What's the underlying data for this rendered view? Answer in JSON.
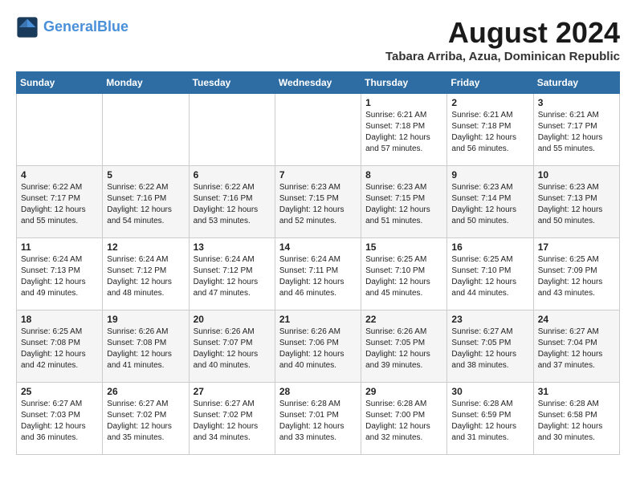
{
  "header": {
    "logo_line1": "General",
    "logo_line2": "Blue",
    "month_year": "August 2024",
    "location": "Tabara Arriba, Azua, Dominican Republic"
  },
  "days_of_week": [
    "Sunday",
    "Monday",
    "Tuesday",
    "Wednesday",
    "Thursday",
    "Friday",
    "Saturday"
  ],
  "weeks": [
    [
      {
        "day": "",
        "content": ""
      },
      {
        "day": "",
        "content": ""
      },
      {
        "day": "",
        "content": ""
      },
      {
        "day": "",
        "content": ""
      },
      {
        "day": "1",
        "content": "Sunrise: 6:21 AM\nSunset: 7:18 PM\nDaylight: 12 hours\nand 57 minutes."
      },
      {
        "day": "2",
        "content": "Sunrise: 6:21 AM\nSunset: 7:18 PM\nDaylight: 12 hours\nand 56 minutes."
      },
      {
        "day": "3",
        "content": "Sunrise: 6:21 AM\nSunset: 7:17 PM\nDaylight: 12 hours\nand 55 minutes."
      }
    ],
    [
      {
        "day": "4",
        "content": "Sunrise: 6:22 AM\nSunset: 7:17 PM\nDaylight: 12 hours\nand 55 minutes."
      },
      {
        "day": "5",
        "content": "Sunrise: 6:22 AM\nSunset: 7:16 PM\nDaylight: 12 hours\nand 54 minutes."
      },
      {
        "day": "6",
        "content": "Sunrise: 6:22 AM\nSunset: 7:16 PM\nDaylight: 12 hours\nand 53 minutes."
      },
      {
        "day": "7",
        "content": "Sunrise: 6:23 AM\nSunset: 7:15 PM\nDaylight: 12 hours\nand 52 minutes."
      },
      {
        "day": "8",
        "content": "Sunrise: 6:23 AM\nSunset: 7:15 PM\nDaylight: 12 hours\nand 51 minutes."
      },
      {
        "day": "9",
        "content": "Sunrise: 6:23 AM\nSunset: 7:14 PM\nDaylight: 12 hours\nand 50 minutes."
      },
      {
        "day": "10",
        "content": "Sunrise: 6:23 AM\nSunset: 7:13 PM\nDaylight: 12 hours\nand 50 minutes."
      }
    ],
    [
      {
        "day": "11",
        "content": "Sunrise: 6:24 AM\nSunset: 7:13 PM\nDaylight: 12 hours\nand 49 minutes."
      },
      {
        "day": "12",
        "content": "Sunrise: 6:24 AM\nSunset: 7:12 PM\nDaylight: 12 hours\nand 48 minutes."
      },
      {
        "day": "13",
        "content": "Sunrise: 6:24 AM\nSunset: 7:12 PM\nDaylight: 12 hours\nand 47 minutes."
      },
      {
        "day": "14",
        "content": "Sunrise: 6:24 AM\nSunset: 7:11 PM\nDaylight: 12 hours\nand 46 minutes."
      },
      {
        "day": "15",
        "content": "Sunrise: 6:25 AM\nSunset: 7:10 PM\nDaylight: 12 hours\nand 45 minutes."
      },
      {
        "day": "16",
        "content": "Sunrise: 6:25 AM\nSunset: 7:10 PM\nDaylight: 12 hours\nand 44 minutes."
      },
      {
        "day": "17",
        "content": "Sunrise: 6:25 AM\nSunset: 7:09 PM\nDaylight: 12 hours\nand 43 minutes."
      }
    ],
    [
      {
        "day": "18",
        "content": "Sunrise: 6:25 AM\nSunset: 7:08 PM\nDaylight: 12 hours\nand 42 minutes."
      },
      {
        "day": "19",
        "content": "Sunrise: 6:26 AM\nSunset: 7:08 PM\nDaylight: 12 hours\nand 41 minutes."
      },
      {
        "day": "20",
        "content": "Sunrise: 6:26 AM\nSunset: 7:07 PM\nDaylight: 12 hours\nand 40 minutes."
      },
      {
        "day": "21",
        "content": "Sunrise: 6:26 AM\nSunset: 7:06 PM\nDaylight: 12 hours\nand 40 minutes."
      },
      {
        "day": "22",
        "content": "Sunrise: 6:26 AM\nSunset: 7:05 PM\nDaylight: 12 hours\nand 39 minutes."
      },
      {
        "day": "23",
        "content": "Sunrise: 6:27 AM\nSunset: 7:05 PM\nDaylight: 12 hours\nand 38 minutes."
      },
      {
        "day": "24",
        "content": "Sunrise: 6:27 AM\nSunset: 7:04 PM\nDaylight: 12 hours\nand 37 minutes."
      }
    ],
    [
      {
        "day": "25",
        "content": "Sunrise: 6:27 AM\nSunset: 7:03 PM\nDaylight: 12 hours\nand 36 minutes."
      },
      {
        "day": "26",
        "content": "Sunrise: 6:27 AM\nSunset: 7:02 PM\nDaylight: 12 hours\nand 35 minutes."
      },
      {
        "day": "27",
        "content": "Sunrise: 6:27 AM\nSunset: 7:02 PM\nDaylight: 12 hours\nand 34 minutes."
      },
      {
        "day": "28",
        "content": "Sunrise: 6:28 AM\nSunset: 7:01 PM\nDaylight: 12 hours\nand 33 minutes."
      },
      {
        "day": "29",
        "content": "Sunrise: 6:28 AM\nSunset: 7:00 PM\nDaylight: 12 hours\nand 32 minutes."
      },
      {
        "day": "30",
        "content": "Sunrise: 6:28 AM\nSunset: 6:59 PM\nDaylight: 12 hours\nand 31 minutes."
      },
      {
        "day": "31",
        "content": "Sunrise: 6:28 AM\nSunset: 6:58 PM\nDaylight: 12 hours\nand 30 minutes."
      }
    ]
  ]
}
